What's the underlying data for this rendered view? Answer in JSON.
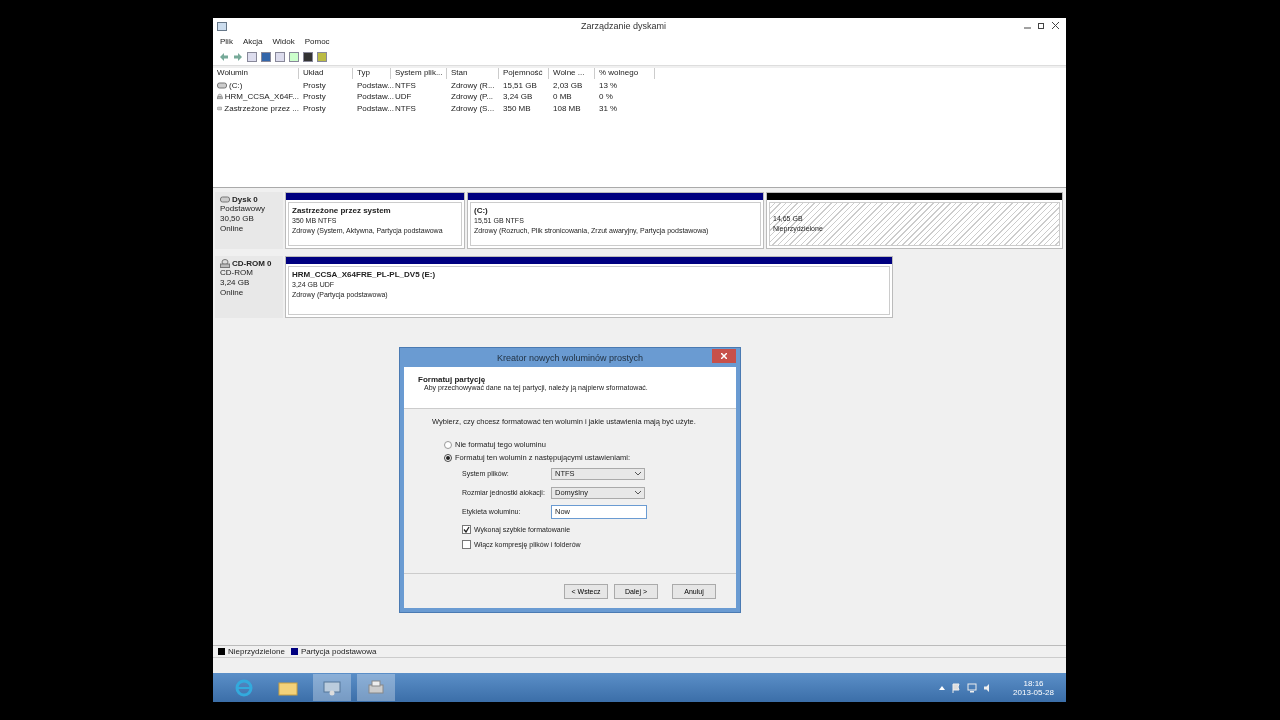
{
  "window": {
    "title": "Zarządzanie dyskami"
  },
  "menu": [
    "Plik",
    "Akcja",
    "Widok",
    "Pomoc"
  ],
  "volumes": {
    "columns": [
      "Wolumin",
      "Układ",
      "Typ",
      "System plik...",
      "Stan",
      "Pojemność",
      "Wolne ...",
      "% wolnego"
    ],
    "rows": [
      {
        "kind": "disk",
        "cells": [
          "(C:)",
          "Prosty",
          "Podstaw...",
          "NTFS",
          "Zdrowy (R...",
          "15,51 GB",
          "2,03 GB",
          "13 %"
        ]
      },
      {
        "kind": "cdrom",
        "cells": [
          "HRM_CCSA_X64F...",
          "Prosty",
          "Podstaw...",
          "UDF",
          "Zdrowy (P...",
          "3,24 GB",
          "0 MB",
          "0 %"
        ]
      },
      {
        "kind": "disk",
        "cells": [
          "Zastrzeżone przez ...",
          "Prosty",
          "Podstaw...",
          "NTFS",
          "Zdrowy (S...",
          "350 MB",
          "108 MB",
          "31 %"
        ]
      }
    ]
  },
  "disks": [
    {
      "kind": "disk",
      "name": "Dysk 0",
      "lines": [
        "Podstawowy",
        "30,50 GB",
        "Online"
      ],
      "partitions": [
        {
          "kind": "primary",
          "title": "Zastrzeżone przez system",
          "size": "350 MB NTFS",
          "status": "Zdrowy (System, Aktywna, Partycja podstawowa"
        },
        {
          "kind": "primary",
          "title": "(C:)",
          "size": "15,51 GB NTFS",
          "status": "Zdrowy (Rozruch, Plik stronicowania, Zrzut awaryjny, Partycja podstawowa)"
        },
        {
          "kind": "unallocated",
          "size": "14,65 GB",
          "status": "Nieprzydzielone"
        }
      ]
    },
    {
      "kind": "cdrom",
      "name": "CD-ROM 0",
      "lines": [
        "CD-ROM",
        "3,24 GB",
        "Online"
      ],
      "partitions": [
        {
          "kind": "primary",
          "title": "HRM_CCSA_X64FRE_PL-PL_DV5  (E:)",
          "size": "3,24 GB UDF",
          "status": "Zdrowy (Partycja podstawowa)"
        }
      ]
    }
  ],
  "legend": [
    {
      "label": "Nieprzydzielone",
      "color": "#000000"
    },
    {
      "label": "Partycja podstawowa",
      "color": "#000080"
    }
  ],
  "dialog": {
    "title": "Kreator nowych woluminów prostych",
    "heading": "Formatuj partycję",
    "subheading": "Aby przechowywać dane na tej partycji, należy ją najpierw sformatować.",
    "prompt": "Wybierz, czy chcesz formatować ten wolumin i jakie ustawienia mają być użyte.",
    "options": [
      {
        "label": "Nie formatuj tego woluminu",
        "selected": false
      },
      {
        "label": "Formatuj ten wolumin z następującymi ustawieniami:",
        "selected": true
      }
    ],
    "fields": [
      {
        "kind": "select",
        "label": "System plików:",
        "value": "NTFS"
      },
      {
        "kind": "select",
        "label": "Rozmiar jednostki alokacji:",
        "value": "Domyślny"
      },
      {
        "kind": "text",
        "label": "Etykieta woluminu:",
        "value": "Now"
      }
    ],
    "checkboxes": [
      {
        "label": "Wykonaj szybkie formatowanie",
        "checked": true
      },
      {
        "label": "Włącz kompresję plików i folderów",
        "checked": false
      }
    ],
    "buttons": [
      "< Wstecz",
      "Dalej >",
      "Anuluj"
    ]
  },
  "clock": {
    "time": "18:16",
    "date": "2013-05-28"
  }
}
